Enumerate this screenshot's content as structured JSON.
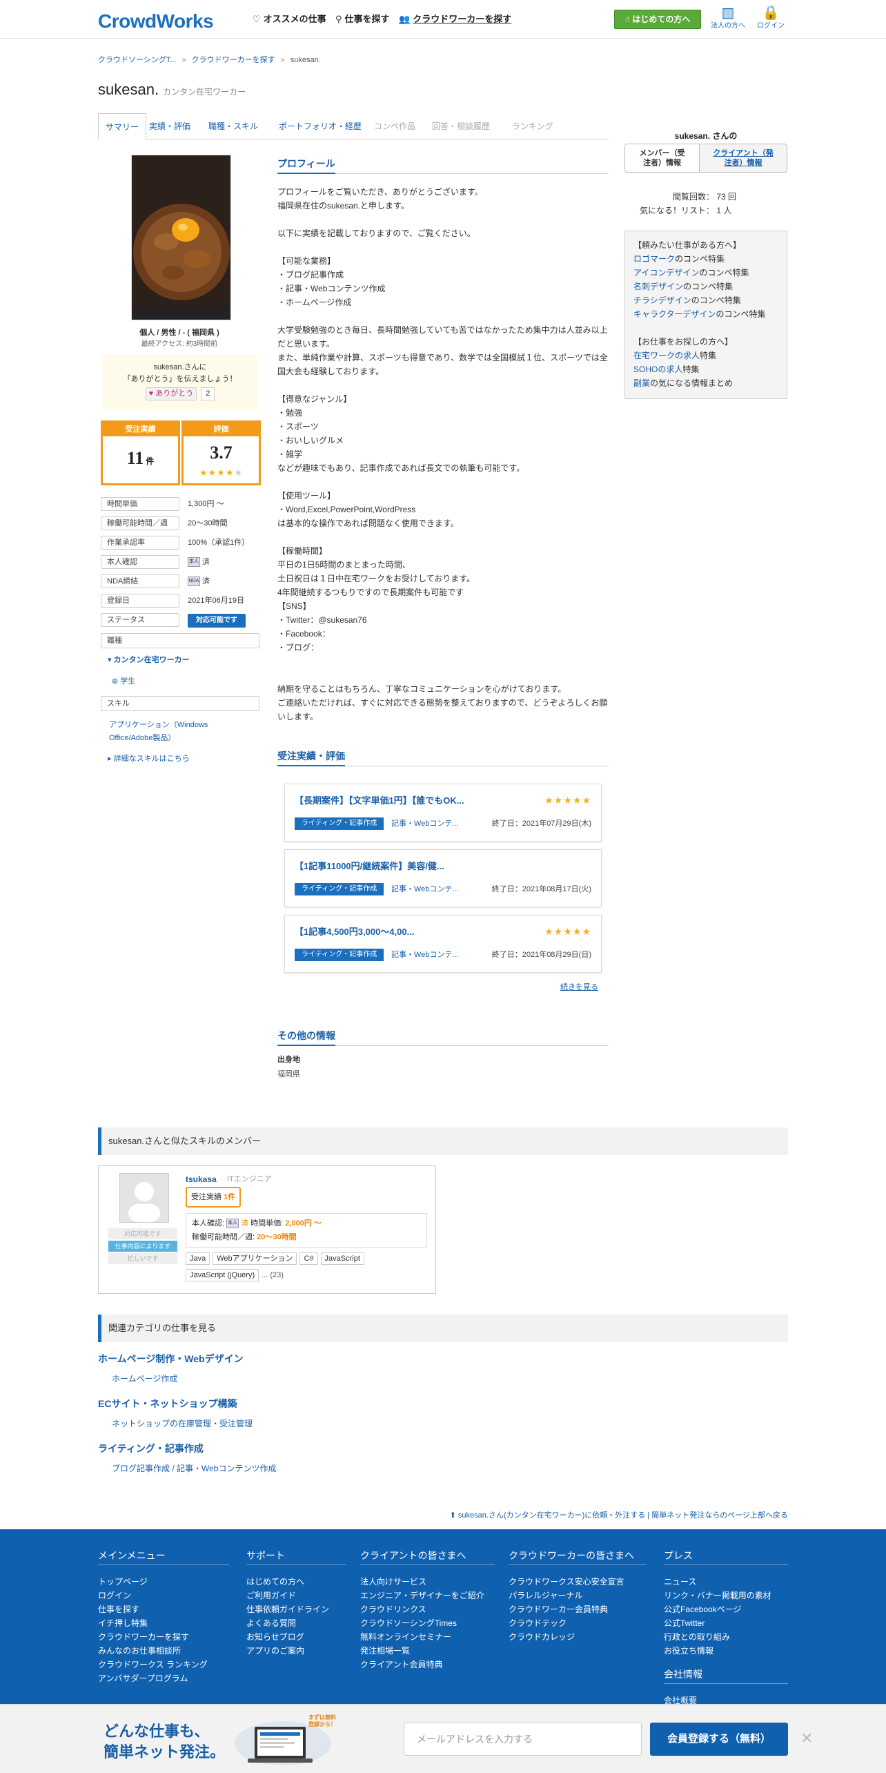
{
  "header": {
    "logo": "CrowdWorks",
    "nav": [
      "オススメの仕事",
      "仕事を探す",
      "クラウドワーカーを探す"
    ],
    "first_button": "はじめての方へ",
    "corp_label": "法人の方へ",
    "login_label": "ログイン"
  },
  "breadcrumb": [
    "クラウドソーシングT...",
    "クラウドワーカーを探す",
    "sukesan."
  ],
  "profile": {
    "name": "sukesan.",
    "type": "カンタン在宅ワーカー",
    "basic": "個人 / 男性 / - ( 福岡県 )",
    "last_access": "最終アクセス: 約3時間前",
    "thanks_line1": "sukesan.さんに",
    "thanks_line2": "「ありがとう」を伝えましょう！",
    "thanks_button": "♥ ありがとう",
    "thanks_count": "2",
    "orders_label": "受注実績",
    "orders_value": "11",
    "orders_unit": "件",
    "rating_label": "評価",
    "rating_value": "3.7",
    "rating_stars": 3.7
  },
  "tabs": [
    "サマリー",
    "実績・評価",
    "職種・スキル",
    "ポートフォリオ・経歴",
    "コンペ作品",
    "回答・相談履歴",
    "ランキング"
  ],
  "info": [
    {
      "label": "時間単価",
      "value": "1,300円 〜"
    },
    {
      "label": "稼働可能時間／週",
      "value": "20〜30時間"
    },
    {
      "label": "作業承認率",
      "value": "100%（承認1件）"
    },
    {
      "label": "本人確認",
      "value": "済"
    },
    {
      "label": "NDA締結",
      "value": "済"
    },
    {
      "label": "登録日",
      "value": "2021年06月19日"
    },
    {
      "label": "ステータス",
      "value": "対応可能です"
    }
  ],
  "left_extra": {
    "job_type_label": "職種",
    "job_type": "カンタン在宅ワーカー",
    "job_sub": "学生",
    "skill_label": "スキル",
    "skill": "アプリケーション（Windows Office/Adobe製品）",
    "more_skill": "詳細なスキルはこちら",
    "nda_icon": "NDA",
    "id_icon": "本人"
  },
  "main": {
    "profile_heading": "プロフィール",
    "profile_text": "プロフィールをご覧いただき、ありがとうございます。\n福岡県在住のsukesan.と申します。\n\n以下に実績を記載しておりますので、ご覧ください。\n\n【可能な業務】\n・ブログ記事作成\n・記事・Webコンテンツ作成\n・ホームページ作成\n\n大学受験勉強のとき毎日、長時間勉強していても苦ではなかったため集中力は人並み以上だと思います。\nまた、単純作業や計算、スポーツも得意であり、数学では全国模試１位、スポーツでは全国大会も経験しております。\n\n【得意なジャンル】\n・勉強\n・スポーツ\n・おいしいグルメ\n・雑学\nなどが趣味でもあり、記事作成であれば長文での執筆も可能です。\n\n【使用ツール】\n・Word,Excel,PowerPoint,WordPress\nは基本的な操作であれば問題なく使用できます。\n\n【稼働時間】\n平日の1日5時間のまとまった時間、\n土日祝日は１日中在宅ワークをお受けしております。\n4年間継続するつもりですので長期案件も可能です\n【SNS】\n・Twitter：@sukesan76\n・Facebook：\n・ブログ：\n\n\n納期を守ることはもちろん、丁寧なコミュニケーションを心がけております。\nご連絡いただければ、すぐに対応できる態勢を整えておりますので、どうぞよろしくお願いします。",
    "jobs_heading": "受注実績・評価",
    "jobs": [
      {
        "title": "【長期案件】【文字単価1円】【誰でもOK...",
        "stars": "★★★★★",
        "category": "ライティング・記事作成",
        "sub": "記事・Webコンテ...",
        "end": "終了日：2021年07月29日(木)"
      },
      {
        "title": "【1記事11000円/継続案件】美容/健...",
        "stars": "",
        "category": "ライティング・記事作成",
        "sub": "記事・Webコンテ...",
        "end": "終了日：2021年08月17日(火)"
      },
      {
        "title": "【1記事4,500円3,000～4,00...",
        "stars": "★★★★★",
        "category": "ライティング・記事作成",
        "sub": "記事・Webコンテ...",
        "end": "終了日：2021年08月29日(日)"
      }
    ],
    "more_link": "続きを見る",
    "other_heading": "その他の情報",
    "origin_label": "出身地",
    "origin_value": "福岡県"
  },
  "right": {
    "title": "sukesan. さんの",
    "tab_member": "メンバー（受注者）情報",
    "tab_client": "クライアント（発注者）情報",
    "views_label": "閲覧回数：",
    "views_value": "73 回",
    "fav_label": "気になる！リスト：",
    "fav_value": "1 人",
    "box_lines": [
      {
        "pre": "",
        "link": "",
        "text": "【頼みたい仕事がある方へ】"
      },
      {
        "pre": "",
        "link": "ロゴマーク",
        "text": "のコンペ特集"
      },
      {
        "pre": "",
        "link": "アイコンデザイン",
        "text": "のコンペ特集"
      },
      {
        "pre": "",
        "link": "名刺デザイン",
        "text": "のコンペ特集"
      },
      {
        "pre": "",
        "link": "チラシデザイン",
        "text": "のコンペ特集"
      },
      {
        "pre": "",
        "link": "キャラクターデザイン",
        "text": "のコンペ特集"
      },
      {
        "pre": "",
        "link": "",
        "text": ""
      },
      {
        "pre": "",
        "link": "",
        "text": "【お仕事をお探しの方へ】"
      },
      {
        "pre": "",
        "link": "在宅ワークの求人",
        "text": "特集"
      },
      {
        "pre": "",
        "link": "SOHOの求人",
        "text": "特集"
      },
      {
        "pre": "",
        "link": "副業",
        "text": "の気になる情報まとめ"
      }
    ]
  },
  "similar": {
    "heading": "sukesan.さんと似たスキルのメンバー",
    "name": "tsukasa",
    "role": "ITエンジニア",
    "orders_label": "受注実績",
    "orders_value": "1件",
    "status1": "対応可能です",
    "status2": "仕事内容によります",
    "status3": "忙しいです",
    "id_label": "本人確認:",
    "id_value": "済",
    "rate_label": "時間単価:",
    "rate_value": "2,000円 〜",
    "hours_label": "稼働可能時間／週:",
    "hours_value": "20〜30時間",
    "tags": [
      "Java",
      "Webアプリケーション",
      "C#",
      "JavaScript",
      "JavaScript (jQuery)"
    ],
    "more_tags": "... (23)"
  },
  "related": {
    "heading": "関連カテゴリの仕事を見る",
    "groups": [
      {
        "title": "ホームページ制作・Webデザイン",
        "items": "ホームページ作成"
      },
      {
        "title": "ECサイト・ネットショップ構築",
        "items": "ネットショップの在庫管理・受注管理"
      },
      {
        "title": "ライティング・記事作成",
        "items": "ブログ記事作成 / 記事・Webコンテンツ作成"
      }
    ],
    "page_top": "sukesan.さん(カンタン在宅ワーカー)に依頼・外注する | 簡単ネット発注ならのページ上部へ戻る"
  },
  "footer": {
    "cols": [
      {
        "title": "メインメニュー",
        "items": [
          "トップページ",
          "ログイン",
          "仕事を探す",
          "イチ押し特集",
          "クラウドワーカーを探す",
          "みんなのお仕事相談所",
          "クラウドワークス ランキング",
          "アンバサダープログラム"
        ]
      },
      {
        "title": "サポート",
        "items": [
          "はじめての方へ",
          "ご利用ガイド",
          "仕事依頼ガイドライン",
          "よくある質問",
          "お知らせブログ",
          "アプリのご案内"
        ]
      },
      {
        "title": "クライアントの皆さまへ",
        "items": [
          "法人向けサービス",
          "エンジニア・デザイナーをご紹介",
          "クラウドリンクス",
          "クラウドソーシングTimes",
          "無料オンラインセミナー",
          "発注相場一覧",
          "クライアント会員特典"
        ]
      },
      {
        "title": "クラウドワーカーの皆さまへ",
        "items": [
          "クラウドワークス安心安全宣言",
          "パラレルジャーナル",
          "クラウドワーカー会員特典",
          "クラウドテック",
          "クラウドカレッジ"
        ]
      },
      {
        "title": "プレス",
        "items": [
          "ニュース",
          "リンク・バナー掲載用の素材",
          "公式Facebookページ",
          "公式Twitter",
          "行政との取り組み",
          "お役立ち情報"
        ]
      }
    ],
    "company_title": "会社情報",
    "company_item": "会社概要"
  },
  "banner": {
    "line1": "どんな仕事も、",
    "line2": "簡単ネット発注。",
    "bubble": "まずは無料登録から！",
    "email_placeholder": "メールアドレスを入力する",
    "register": "会員登録する（無料）",
    "close": "✕"
  }
}
